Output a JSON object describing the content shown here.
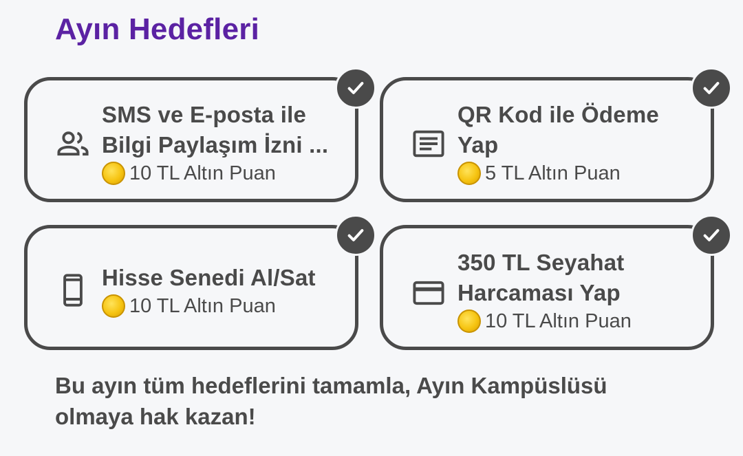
{
  "header": {
    "title": "Ayın Hedefleri"
  },
  "goals": [
    {
      "label": "SMS ve E-posta ile\nBilgi Paylaşım İzni ...",
      "reward": "10 TL Altın Puan",
      "icon": "people-icon",
      "completed": true
    },
    {
      "label": "QR Kod ile Ödeme\nYap",
      "reward": "5 TL Altın Puan",
      "icon": "receipt-icon",
      "completed": true
    },
    {
      "label": "Hisse Senedi Al/Sat",
      "reward": "10 TL Altın Puan",
      "icon": "phone-icon",
      "completed": true
    },
    {
      "label": "350 TL Seyahat\nHarcaması Yap",
      "reward": "10 TL Altın Puan",
      "icon": "credit-card-icon",
      "completed": true
    }
  ],
  "footer": {
    "text": "Bu ayın tüm hedeflerini tamamla, Ayın Kampüslüsü olmaya hak kazan!"
  },
  "colors": {
    "title": "#5b22a3",
    "text": "#4a4a4a",
    "background": "#f6f7f9",
    "coin": "#f6c412"
  }
}
